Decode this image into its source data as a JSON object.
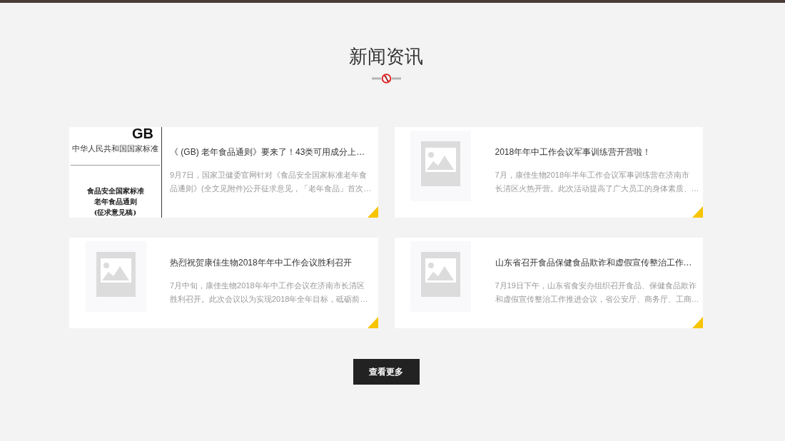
{
  "section": {
    "title": "新闻资讯"
  },
  "news": [
    {
      "title": "《 (GB) 老年食品通则》要来了！43类可用成分上…",
      "summary_lines": [
        "9月7日，国家卫健委官网针对《食品安全国家标准老年食",
        "品通则》(全文见附件)公开征求意见，「老年食品」首次…"
      ],
      "thumbnail": {
        "kind": "document",
        "logo": "GB",
        "heading": "中华人民共和国国家标准",
        "lines": [
          "食品安全国家标准",
          "老年食品通则",
          "(征求意见稿)"
        ]
      }
    },
    {
      "title": "2018年年中工作会议军事训练营开营啦！",
      "summary_lines": [
        "7月，康佳生物2018年半年工作会议军事训练营在济南市",
        "长清区火热开营。此次活动提高了广大员工的身体素质、…"
      ],
      "thumbnail": {
        "kind": "placeholder"
      }
    },
    {
      "title": "热烈祝贺康佳生物2018年年中工作会议胜利召开",
      "summary_lines": [
        "7月中旬，康佳生物2018年年中工作会议在济南市长清区",
        "胜利召开。此次会议以为实现2018年全年目标，砥砺前…"
      ],
      "thumbnail": {
        "kind": "placeholder"
      }
    },
    {
      "title": "山东省召开食品保健食品欺诈和虚假宣传整治工作…",
      "summary_lines": [
        "7月19日下午，山东省食安办组织召开食品、保健食品欺诈",
        "和虚假宣传整治工作推进会议，省公安厅、商务厅、工商…"
      ],
      "thumbnail": {
        "kind": "placeholder"
      }
    }
  ],
  "more_button": {
    "label": "查看更多"
  }
}
